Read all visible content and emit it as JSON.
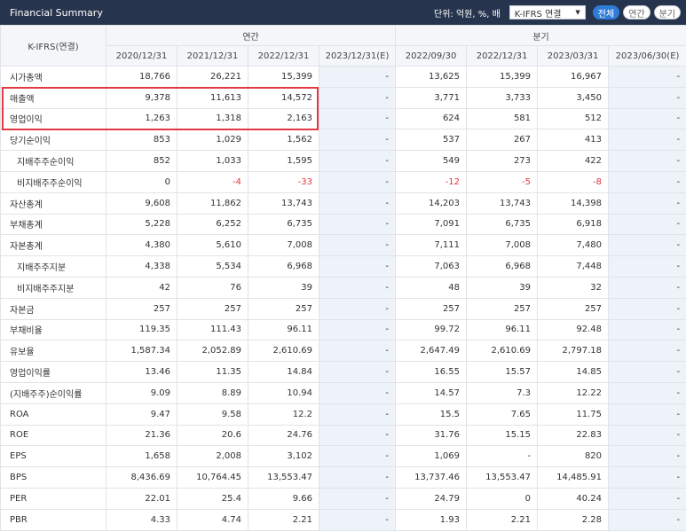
{
  "header": {
    "title": "Financial Summary",
    "unit": "단위: 억원, %, 배",
    "standard_select": "K-IFRS 연결",
    "view_buttons": [
      "전체",
      "연간",
      "분기"
    ],
    "active_view": "전체"
  },
  "table": {
    "corner_label": "K-IFRS(연결)",
    "group_annual": "연간",
    "group_quarter": "분기",
    "periods": [
      "2020/12/31",
      "2021/12/31",
      "2022/12/31",
      "2023/12/31(E)",
      "2022/09/30",
      "2022/12/31",
      "2023/03/31",
      "2023/06/30(E)"
    ],
    "rows": [
      {
        "label": "시가총액",
        "indent": false,
        "values": [
          "18,766",
          "26,221",
          "15,399",
          "-",
          "13,625",
          "15,399",
          "16,967",
          "-"
        ]
      },
      {
        "label": "매출액",
        "indent": false,
        "values": [
          "9,378",
          "11,613",
          "14,572",
          "-",
          "3,771",
          "3,733",
          "3,450",
          "-"
        ]
      },
      {
        "label": "영업이익",
        "indent": false,
        "values": [
          "1,263",
          "1,318",
          "2,163",
          "-",
          "624",
          "581",
          "512",
          "-"
        ]
      },
      {
        "label": "당기순이익",
        "indent": false,
        "values": [
          "853",
          "1,029",
          "1,562",
          "-",
          "537",
          "267",
          "413",
          "-"
        ]
      },
      {
        "label": "지배주주순이익",
        "indent": true,
        "values": [
          "852",
          "1,033",
          "1,595",
          "-",
          "549",
          "273",
          "422",
          "-"
        ]
      },
      {
        "label": "비지배주주순이익",
        "indent": true,
        "values": [
          "0",
          "-4",
          "-33",
          "-",
          "-12",
          "-5",
          "-8",
          "-"
        ]
      },
      {
        "label": "자산총계",
        "indent": false,
        "values": [
          "9,608",
          "11,862",
          "13,743",
          "-",
          "14,203",
          "13,743",
          "14,398",
          "-"
        ]
      },
      {
        "label": "부채총계",
        "indent": false,
        "values": [
          "5,228",
          "6,252",
          "6,735",
          "-",
          "7,091",
          "6,735",
          "6,918",
          "-"
        ]
      },
      {
        "label": "자본총계",
        "indent": false,
        "values": [
          "4,380",
          "5,610",
          "7,008",
          "-",
          "7,111",
          "7,008",
          "7,480",
          "-"
        ]
      },
      {
        "label": "지배주주지분",
        "indent": true,
        "values": [
          "4,338",
          "5,534",
          "6,968",
          "-",
          "7,063",
          "6,968",
          "7,448",
          "-"
        ]
      },
      {
        "label": "비지배주주지분",
        "indent": true,
        "values": [
          "42",
          "76",
          "39",
          "-",
          "48",
          "39",
          "32",
          "-"
        ]
      },
      {
        "label": "자본금",
        "indent": false,
        "values": [
          "257",
          "257",
          "257",
          "-",
          "257",
          "257",
          "257",
          "-"
        ]
      },
      {
        "label": "부채비율",
        "indent": false,
        "values": [
          "119.35",
          "111.43",
          "96.11",
          "-",
          "99.72",
          "96.11",
          "92.48",
          "-"
        ]
      },
      {
        "label": "유보율",
        "indent": false,
        "values": [
          "1,587.34",
          "2,052.89",
          "2,610.69",
          "-",
          "2,647.49",
          "2,610.69",
          "2,797.18",
          "-"
        ]
      },
      {
        "label": "영업이익률",
        "indent": false,
        "values": [
          "13.46",
          "11.35",
          "14.84",
          "-",
          "16.55",
          "15.57",
          "14.85",
          "-"
        ]
      },
      {
        "label": "(지배주주)순이익률",
        "indent": false,
        "values": [
          "9.09",
          "8.89",
          "10.94",
          "-",
          "14.57",
          "7.3",
          "12.22",
          "-"
        ]
      },
      {
        "label": "ROA",
        "indent": false,
        "values": [
          "9.47",
          "9.58",
          "12.2",
          "-",
          "15.5",
          "7.65",
          "11.75",
          "-"
        ]
      },
      {
        "label": "ROE",
        "indent": false,
        "values": [
          "21.36",
          "20.6",
          "24.76",
          "-",
          "31.76",
          "15.15",
          "22.83",
          "-"
        ]
      },
      {
        "label": "EPS",
        "indent": false,
        "values": [
          "1,658",
          "2,008",
          "3,102",
          "-",
          "1,069",
          "-",
          "820",
          "-"
        ]
      },
      {
        "label": "BPS",
        "indent": false,
        "values": [
          "8,436.69",
          "10,764.45",
          "13,553.47",
          "-",
          "13,737.46",
          "13,553.47",
          "14,485.91",
          "-"
        ]
      },
      {
        "label": "PER",
        "indent": false,
        "values": [
          "22.01",
          "25.4",
          "9.66",
          "-",
          "24.79",
          "0",
          "40.24",
          "-"
        ]
      },
      {
        "label": "PBR",
        "indent": false,
        "values": [
          "4.33",
          "4.74",
          "2.21",
          "-",
          "1.93",
          "2.21",
          "2.28",
          "-"
        ]
      }
    ]
  },
  "colors": {
    "header_bg": "#27344d",
    "active_button": "#2e7cd8",
    "negative": "#e0383e",
    "highlight_border": "#e23a44"
  }
}
